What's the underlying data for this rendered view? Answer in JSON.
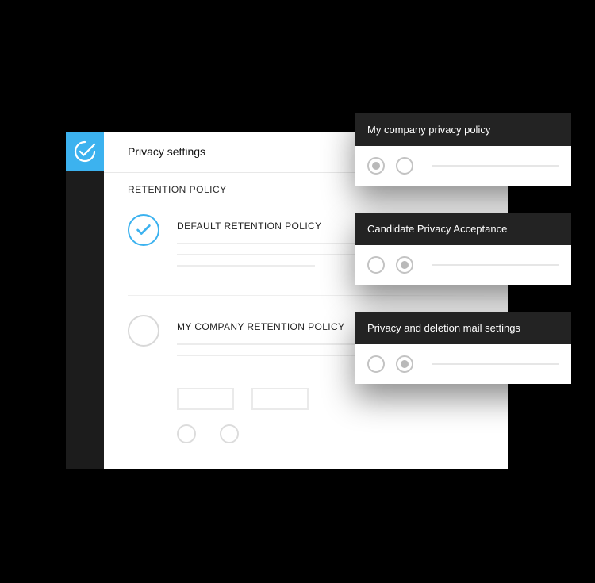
{
  "page": {
    "title": "Privacy settings",
    "section": "RETENTION POLICY"
  },
  "options": {
    "default": {
      "title": "DEFAULT RETENTION POLICY"
    },
    "custom": {
      "title": "MY COMPANY RETENTION POLICY"
    }
  },
  "cards": {
    "card1": {
      "title": "My company privacy policy",
      "radio1_filled": true,
      "radio2_filled": false
    },
    "card2": {
      "title": "Candidate Privacy Acceptance",
      "radio1_filled": false,
      "radio2_filled": true
    },
    "card3": {
      "title": "Privacy and deletion mail settings",
      "radio1_filled": false,
      "radio2_filled": true
    }
  },
  "colors": {
    "accent": "#3cb2ef",
    "sidebar": "#1c1c1c",
    "card_header": "#232323"
  }
}
